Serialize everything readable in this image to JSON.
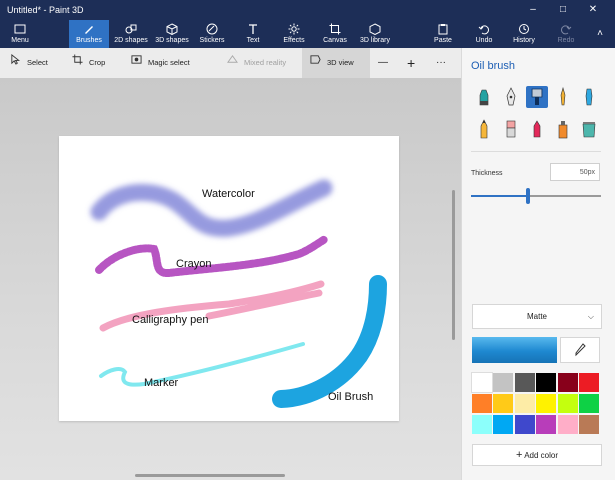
{
  "window": {
    "title": "Untitled* - Paint 3D",
    "minimize_glyph": "–",
    "maximize_glyph": "□",
    "close_glyph": "✕"
  },
  "ribbon": {
    "menu": "Menu",
    "brushes": "Brushes",
    "shapes2d": "2D shapes",
    "shapes3d": "3D shapes",
    "stickers": "Stickers",
    "text": "Text",
    "effects": "Effects",
    "canvas": "Canvas",
    "library3d": "3D library",
    "paste": "Paste",
    "undo": "Undo",
    "history": "History",
    "redo": "Redo",
    "collapse_glyph": "˄"
  },
  "toolbar": {
    "select": "Select",
    "crop": "Crop",
    "magic_select": "Magic select",
    "mixed_reality": "Mixed reality",
    "view3d": "3D view",
    "zoom_out_glyph": "—",
    "zoom_in_glyph": "+",
    "more_glyph": "···"
  },
  "canvas_labels": {
    "watercolor": "Watercolor",
    "crayon": "Crayon",
    "calligraphy": "Calligraphy pen",
    "marker": "Marker",
    "oil": "Oil Brush"
  },
  "panel": {
    "title": "Oil brush",
    "thickness_label": "Thickness",
    "thickness_value": "50px",
    "thickness_fraction": 0.44,
    "finish": "Matte",
    "finish_chevron": "⌵",
    "add_color": "Add color",
    "add_plus": "+",
    "current_color": "#1e88d0",
    "tools": [
      "marker-icon",
      "calligraphy-pen-icon",
      "oil-brush-icon",
      "watercolor-icon",
      "pencil-icon",
      "eraser-icon",
      "crayon-icon",
      "pixel-pen-icon",
      "spray-can-icon",
      "fill-bucket-icon"
    ],
    "selected_tool": "oil-brush-icon",
    "palette": [
      "#ffffff",
      "#c3c3c3",
      "#585858",
      "#000000",
      "#88001b",
      "#ec1c24",
      "#ff7f27",
      "#ffca18",
      "#fdeca6",
      "#fff200",
      "#c4ff0e",
      "#0ed145",
      "#8cfffb",
      "#00a8f3",
      "#3f48cc",
      "#b83dba",
      "#ffaec8",
      "#b97a56"
    ]
  }
}
